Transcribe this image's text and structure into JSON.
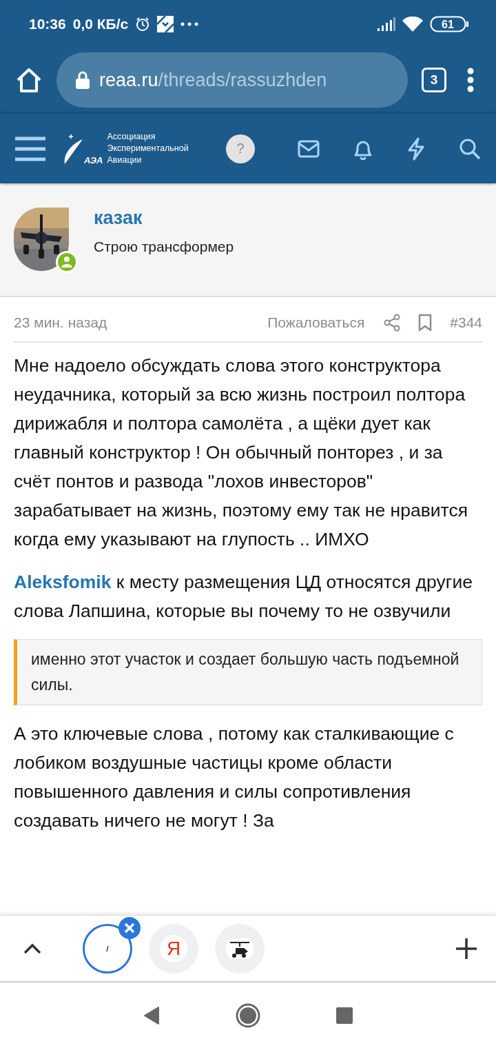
{
  "status_bar": {
    "time": "10:36",
    "speed": "0,0 КБ/с",
    "battery": "61"
  },
  "browser": {
    "url_host": "reaa.ru",
    "url_path": "/threads/rassuzhden",
    "tab_count": "3"
  },
  "site_header": {
    "logo_mark": "АЭА",
    "logo_lines": [
      "Ассоциация",
      "Экспериментальной",
      "Авиации"
    ],
    "help": "?"
  },
  "author": {
    "name": "казак",
    "title": "Строю трансформер",
    "online": true
  },
  "post_meta": {
    "time": "23 мин. назад",
    "report": "Пожаловаться",
    "number": "#344"
  },
  "body": [
    {
      "kind": "paragraph",
      "text": "Мне надоело обсуждать слова этого конструктора неудачника, который за всю жизнь построил полтора дирижабля и полтора самолёта , а щёки дует как главный конструктор ! Он обычный понторез , и за счёт понтов и развода \"лохов инвесторов\" зарабатывает на жизнь, поэтому ему так не нравится когда ему указывают на глупость .. ИМХО"
    },
    {
      "kind": "reply",
      "mention": "Aleksfomik",
      "text": "к месту размещения ЦД относятся другие слова Лапшина, которые вы почему то не озвучили"
    },
    {
      "kind": "quote",
      "text": "именно этот участок и создает большую часть подъемной силы."
    },
    {
      "kind": "paragraph",
      "text": "А это ключевые слова , потому как сталкивающие с лобиком воздушные частицы кроме области повышенного давления и силы сопротивления создавать ничего не могут ! За"
    }
  ],
  "tab_strip": [
    {
      "kind": "page",
      "selected": true
    },
    {
      "kind": "letter",
      "letter": "Я",
      "selected": false
    },
    {
      "kind": "site",
      "selected": false
    }
  ]
}
